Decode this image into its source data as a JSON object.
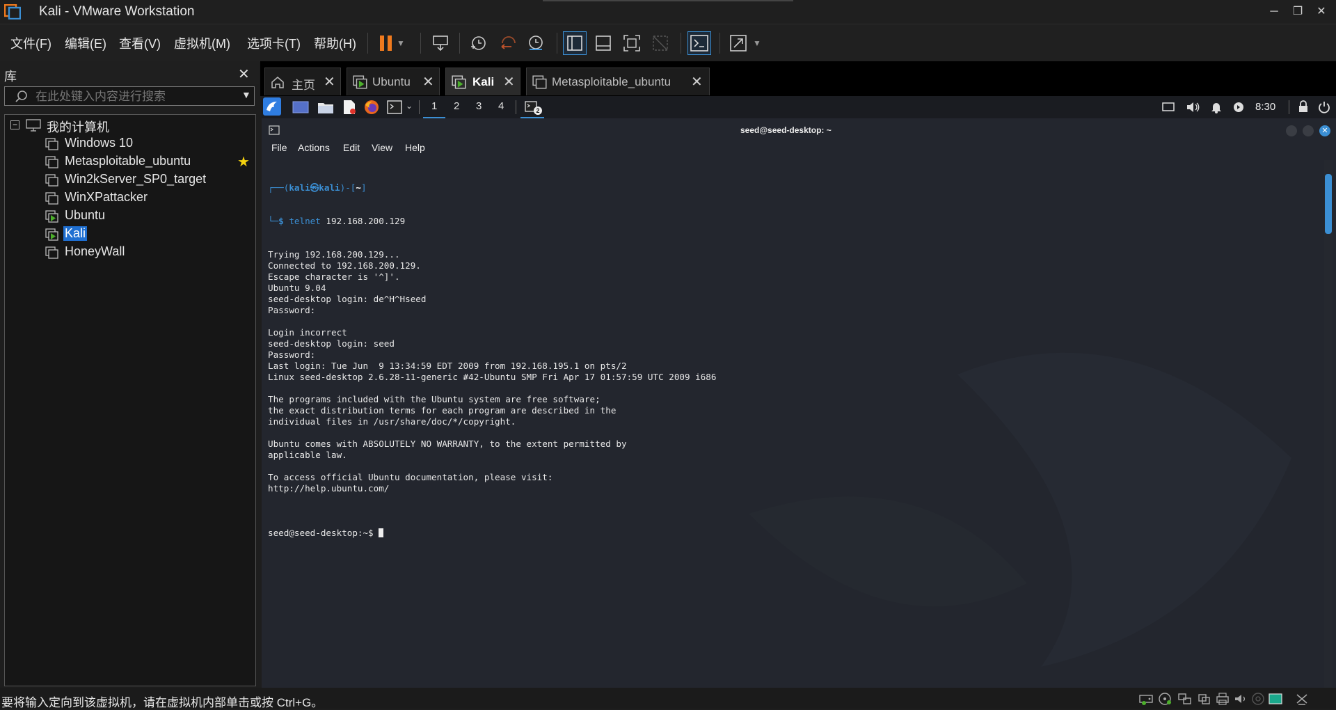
{
  "window": {
    "title": "Kali - VMware Workstation"
  },
  "menu": {
    "items": [
      "文件(F)",
      "编辑(E)",
      "查看(V)",
      "虚拟机(M)",
      "选项卡(T)",
      "帮助(H)"
    ]
  },
  "library": {
    "title": "库",
    "search_placeholder": "在此处键入内容进行搜索",
    "root": "我的计算机",
    "vms": [
      "Windows 10",
      "Metasploitable_ubuntu",
      "Win2kServer_SP0_target",
      "WinXPattacker",
      "Ubuntu",
      "Kali",
      "HoneyWall"
    ]
  },
  "tabs": [
    {
      "label": "主页"
    },
    {
      "label": "Ubuntu"
    },
    {
      "label": "Kali"
    },
    {
      "label": "Metasploitable_ubuntu"
    }
  ],
  "guest_panel": {
    "workspaces": [
      "1",
      "2",
      "3",
      "4"
    ],
    "terminal_badge": "2",
    "clock": "8:30"
  },
  "terminal": {
    "title": "seed@seed-desktop: ~",
    "menu": [
      "File",
      "Actions",
      "Edit",
      "View",
      "Help"
    ],
    "prompt_user": "kali",
    "prompt_at": "㉿",
    "prompt_host": "kali",
    "prompt_dir": "~",
    "command": "telnet",
    "command_args": " 192.168.200.129",
    "lines": [
      "Trying 192.168.200.129...",
      "Connected to 192.168.200.129.",
      "Escape character is '^]'.",
      "Ubuntu 9.04",
      "seed-desktop login: de^H^Hseed",
      "Password:",
      "",
      "Login incorrect",
      "seed-desktop login: seed",
      "Password:",
      "Last login: Tue Jun  9 13:34:59 EDT 2009 from 192.168.195.1 on pts/2",
      "Linux seed-desktop 2.6.28-11-generic #42-Ubuntu SMP Fri Apr 17 01:57:59 UTC 2009 i686",
      "",
      "The programs included with the Ubuntu system are free software;",
      "the exact distribution terms for each program are described in the",
      "individual files in /usr/share/doc/*/copyright.",
      "",
      "Ubuntu comes with ABSOLUTELY NO WARRANTY, to the extent permitted by",
      "applicable law.",
      "",
      "To access official Ubuntu documentation, please visit:",
      "http://help.ubuntu.com/",
      ""
    ],
    "final_prompt": "seed@seed-desktop:~$ "
  },
  "status": {
    "text": "要将输入定向到该虚拟机，请在虚拟机内部单击或按 Ctrl+G。"
  },
  "colors": {
    "accent": "#3b8fd4",
    "pause": "#f07a1e",
    "vm_running": "#4caf2b",
    "star": "#f5d20f"
  }
}
